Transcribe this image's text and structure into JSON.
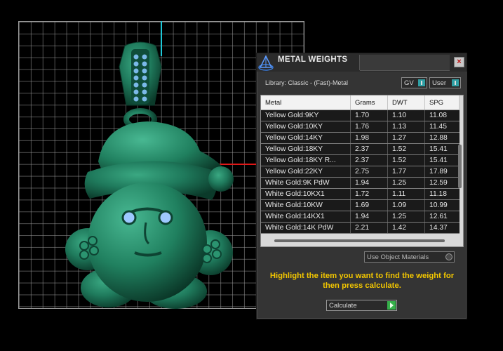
{
  "dialog": {
    "title": "METAL WEIGHTS",
    "close_glyph": "×",
    "library_label": "Library: Classic - (Fast)-Metal",
    "dropdown_gv": "GV",
    "dropdown_user": "User",
    "columns": [
      "Metal",
      "Grams",
      "DWT",
      "SPG"
    ],
    "rows": [
      {
        "metal": "Yellow Gold:9KY",
        "grams": "1.70",
        "dwt": "1.10",
        "spg": "11.08"
      },
      {
        "metal": "Yellow Gold:10KY",
        "grams": "1.76",
        "dwt": "1.13",
        "spg": "11.45"
      },
      {
        "metal": "Yellow Gold:14KY",
        "grams": "1.98",
        "dwt": "1.27",
        "spg": "12.88"
      },
      {
        "metal": "Yellow Gold:18KY",
        "grams": "2.37",
        "dwt": "1.52",
        "spg": "15.41"
      },
      {
        "metal": "Yellow Gold:18KY R...",
        "grams": "2.37",
        "dwt": "1.52",
        "spg": "15.41"
      },
      {
        "metal": "Yellow Gold:22KY",
        "grams": "2.75",
        "dwt": "1.77",
        "spg": "17.89"
      },
      {
        "metal": "White Gold:9K PdW",
        "grams": "1.94",
        "dwt": "1.25",
        "spg": "12.59"
      },
      {
        "metal": "White Gold:10KX1",
        "grams": "1.72",
        "dwt": "1.11",
        "spg": "11.18"
      },
      {
        "metal": "White Gold:10KW",
        "grams": "1.69",
        "dwt": "1.09",
        "spg": "10.99"
      },
      {
        "metal": "White Gold:14KX1",
        "grams": "1.94",
        "dwt": "1.25",
        "spg": "12.61"
      },
      {
        "metal": "White Gold:14K PdW",
        "grams": "2.21",
        "dwt": "1.42",
        "spg": "14.37"
      }
    ],
    "use_object_materials": "Use Object Materials",
    "hint": "Highlight the item you want to find the weight for then press calculate.",
    "calculate_label": "Calculate"
  },
  "colors": {
    "accent_teal": "#2f9fa4",
    "hint_yellow": "#f2c600",
    "model_green": "#1f7a5c"
  }
}
